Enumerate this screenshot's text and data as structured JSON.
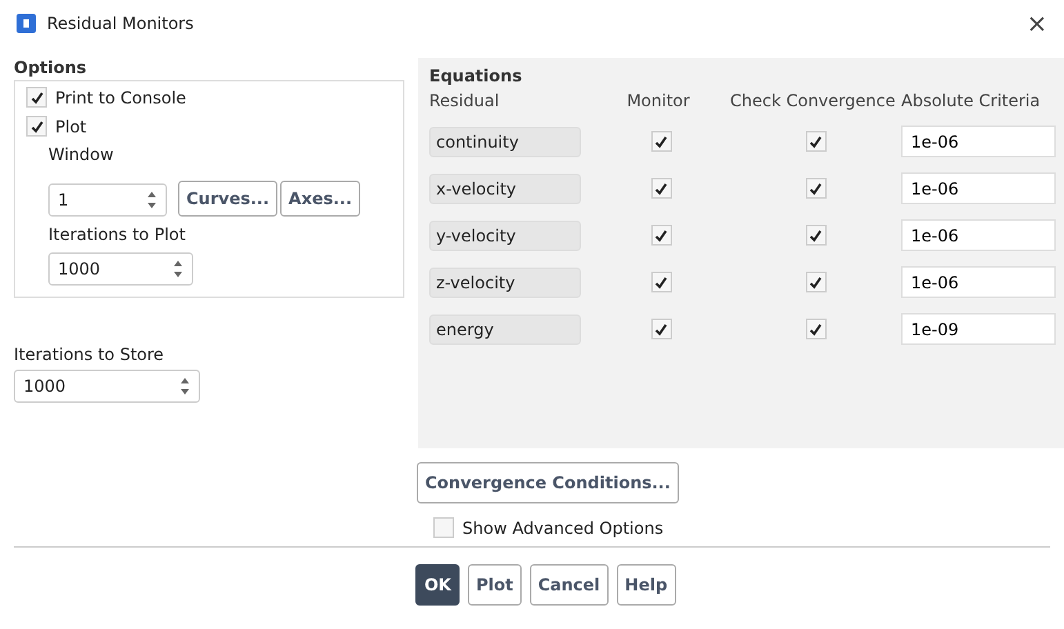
{
  "window": {
    "title": "Residual Monitors",
    "close": "×"
  },
  "options": {
    "title": "Options",
    "print_to_console": {
      "label": "Print to Console",
      "checked": true
    },
    "plot": {
      "label": "Plot",
      "checked": true
    },
    "window_label": "Window",
    "window_value": "1",
    "curves_button": "Curves...",
    "axes_button": "Axes...",
    "iterations_to_plot_label": "Iterations to Plot",
    "iterations_to_plot": "1000"
  },
  "iterations_to_store_label": "Iterations to Store",
  "iterations_to_store": "1000",
  "equations": {
    "title": "Equations",
    "columns": [
      "Residual",
      "Monitor",
      "Check Convergence",
      "Absolute Criteria"
    ],
    "rows": [
      {
        "residual": "continuity",
        "monitor": true,
        "check_convergence": true,
        "absolute_criteria": "1e-06"
      },
      {
        "residual": "x-velocity",
        "monitor": true,
        "check_convergence": true,
        "absolute_criteria": "1e-06"
      },
      {
        "residual": "y-velocity",
        "monitor": true,
        "check_convergence": true,
        "absolute_criteria": "1e-06"
      },
      {
        "residual": "z-velocity",
        "monitor": true,
        "check_convergence": true,
        "absolute_criteria": "1e-06"
      },
      {
        "residual": "energy",
        "monitor": true,
        "check_convergence": true,
        "absolute_criteria": "1e-09"
      }
    ]
  },
  "convergence_button": "Convergence Conditions...",
  "show_advanced": {
    "label": "Show Advanced Options",
    "checked": false
  },
  "buttons": [
    {
      "label": "OK",
      "primary": true
    },
    {
      "label": "Plot",
      "primary": false
    },
    {
      "label": "Cancel",
      "primary": false
    },
    {
      "label": "Help",
      "primary": false
    }
  ]
}
